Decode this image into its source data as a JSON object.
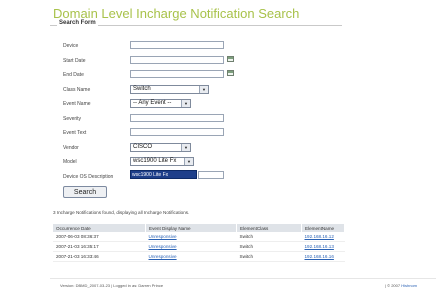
{
  "page": {
    "title": "Domain Level Incharge Notification Search"
  },
  "form": {
    "legend": "Search Form",
    "fields": [
      {
        "label": "Device",
        "value": ""
      },
      {
        "label": "Start Date",
        "value": ""
      },
      {
        "label": "End Date",
        "value": ""
      },
      {
        "label": "Class Name",
        "value": "Switch"
      },
      {
        "label": "Event Name",
        "value": "-- Any Event --"
      },
      {
        "label": "Severity",
        "value": ""
      },
      {
        "label": "Event Text",
        "value": ""
      },
      {
        "label": "Vendor",
        "value": "CISCO"
      },
      {
        "label": "Model",
        "value": "wsc1900 Lite Fx"
      },
      {
        "label": "Device OS Description",
        "value": ""
      }
    ],
    "model_dropdown_option": "wsc1900 Lite Fx",
    "search_button": "Search"
  },
  "results": {
    "summary": "3 Incharge Notifications found, displaying all Incharge Notifications.",
    "columns": [
      "Occurrence Date",
      "Event Display Name",
      "ElementClass",
      "ElementName"
    ],
    "rows": [
      [
        "2007-06-03 08:36:37",
        "Unresponsive",
        "Switch",
        "192.168.16.12"
      ],
      [
        "2007-21-03 16:35:17",
        "Unresponsive",
        "Switch",
        "192.168.16.13"
      ],
      [
        "2007-21-03 16:33:46",
        "Unresponsive",
        "Switch",
        "192.168.16.16"
      ]
    ]
  },
  "footer": {
    "left": "Version: DBMD_2007-03-23 | Logged in as: Darren Prince",
    "right_prefix": "| © 2007",
    "right_brand": "Hishnom"
  }
}
